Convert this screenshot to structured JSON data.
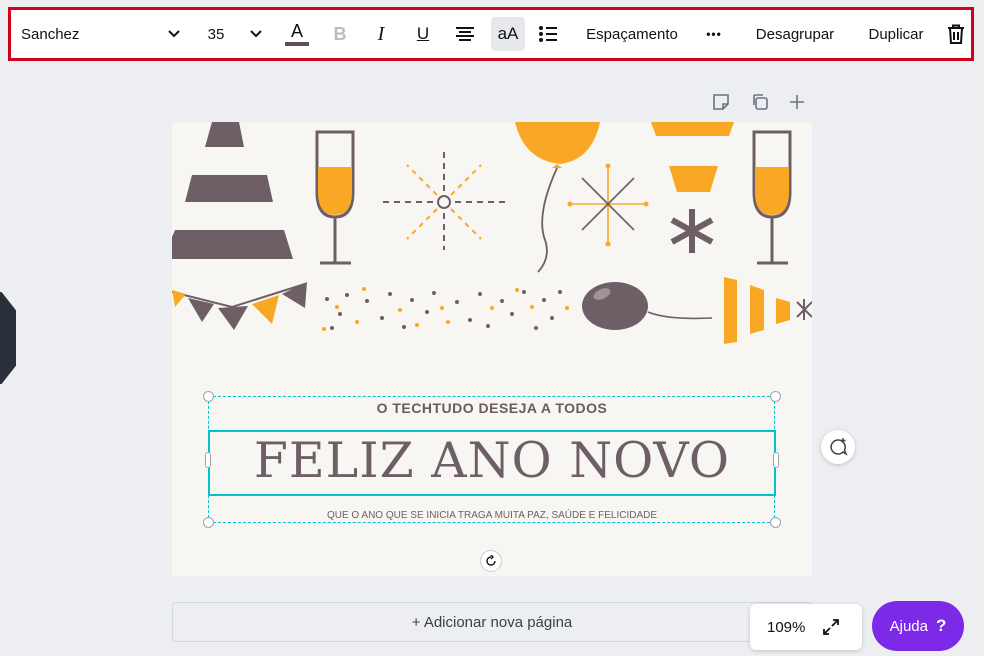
{
  "toolbar": {
    "font_name": "Sanchez",
    "font_size": "35",
    "text_color_glyph": "A",
    "bold_glyph": "B",
    "italic_glyph": "I",
    "underline_glyph": "U",
    "case_glyph": "aA",
    "spacing_label": "Espaçamento",
    "more_glyph": "•••",
    "ungroup_label": "Desagrupar",
    "duplicate_label": "Duplicar"
  },
  "canvas": {
    "subtitle": "O TECHTUDO DESEJA A TODOS",
    "headline": "FELIZ ANO NOVO",
    "tagline": "QUE O ANO QUE SE INICIA TRAGA MUITA PAZ, SAÚDE E FELICIDADE"
  },
  "footer": {
    "add_page_label": "+ Adicionar nova página",
    "zoom_level": "109%",
    "help_label": "Ajuda",
    "help_glyph": "?"
  },
  "colors": {
    "highlight_border": "#d0021b",
    "selection": "#00c4cc",
    "text_color_bar": "#5e4f57",
    "help_bg": "#7d2ae8",
    "orange": "#f9a825",
    "mauve": "#6e5e66"
  },
  "icons": {
    "font_dropdown": "chevron-down-icon",
    "size_dropdown": "chevron-down-icon",
    "align": "align-center-icon",
    "list": "list-icon",
    "delete": "trash-icon",
    "notes": "note-icon",
    "copy_page": "copy-icon",
    "add_page": "plus-icon",
    "expand": "expand-icon",
    "rotate": "rotate-icon",
    "comment": "comment-add-icon"
  }
}
